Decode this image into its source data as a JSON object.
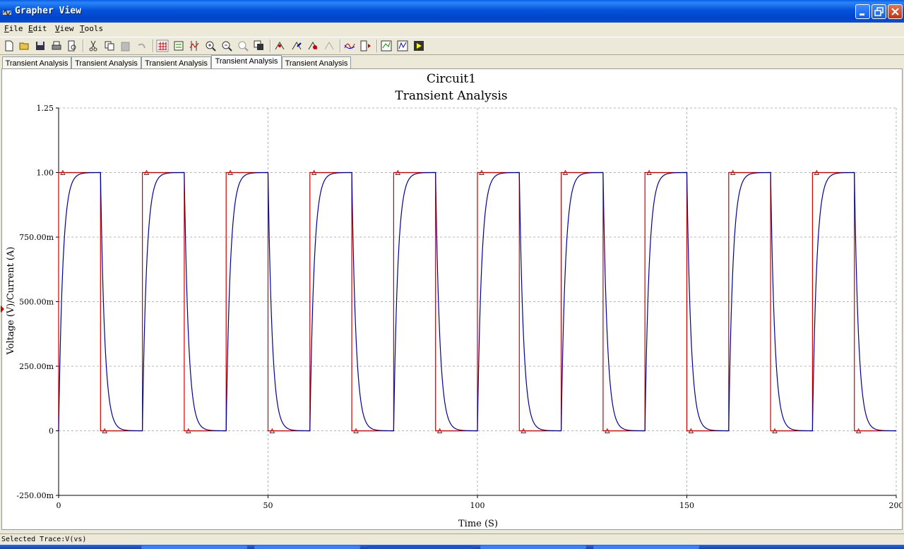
{
  "window": {
    "title": "Grapher View"
  },
  "menu": [
    "File",
    "Edit",
    "View",
    "Tools"
  ],
  "toolbar_icons": [
    "new-icon",
    "open-icon",
    "save-icon",
    "print-icon",
    "print-preview-icon",
    "cut-icon",
    "copy-icon",
    "paste-icon",
    "undo-icon",
    "toggle-grid-icon",
    "toggle-legend-icon",
    "show-cursors-icon",
    "zoom-in-icon",
    "zoom-out-icon",
    "zoom-full-icon",
    "overlay-traces-icon",
    "select-marks-icon",
    "reverse-colors-icon",
    "export-excel-icon",
    "export-lab-icon",
    "add-trace-icon",
    "trace-properties-icon",
    "export-to-postprocessor-icon",
    "chart-properties-icon",
    "run-icon"
  ],
  "tabs": [
    {
      "label": "Transient Analysis"
    },
    {
      "label": "Transient Analysis"
    },
    {
      "label": "Transient Analysis"
    },
    {
      "label": "Transient Analysis",
      "active": true
    },
    {
      "label": "Transient Analysis"
    }
  ],
  "status": {
    "text": "Selected Trace:V(vs)"
  },
  "colors": {
    "input_trace": "#cc0000",
    "output_trace": "#000099",
    "grid": "#a0a0a0"
  },
  "chart_data": {
    "type": "line",
    "title": "Circuit1",
    "subtitle": "Transient Analysis",
    "xlabel": "Time (S)",
    "ylabel": "Voltage (V)/Current (A)",
    "xlim": [
      0,
      200
    ],
    "ylim": [
      -0.25,
      1.25
    ],
    "x_ticks": [
      0,
      50,
      100,
      150,
      200
    ],
    "x_tick_labels": [
      "0",
      "50",
      "100",
      "150",
      "200"
    ],
    "y_ticks": [
      -0.25,
      0,
      0.25,
      0.5,
      0.75,
      1.0,
      1.25
    ],
    "y_tick_labels": [
      "-250.00m",
      "0",
      "250.00m",
      "500.00m",
      "750.00m",
      "1.00",
      "1.25"
    ],
    "grid": true,
    "series": [
      {
        "color": "#cc0000",
        "kind": "square wave",
        "period": 20,
        "high_duration": 10,
        "high": 1.0,
        "low": 0.0,
        "marker": "triangle"
      },
      {
        "color": "#000099",
        "kind": "RC response",
        "period": 20,
        "high_duration": 10,
        "time_constant": 1.0,
        "high": 1.0,
        "low": 0.0
      }
    ]
  }
}
